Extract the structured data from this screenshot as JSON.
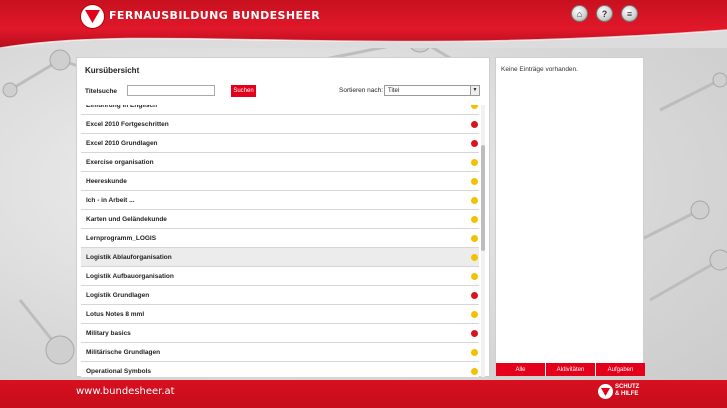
{
  "header": {
    "brand": "FERNAUSBILDUNG BUNDESHEER",
    "buttons": [
      {
        "name": "home-icon",
        "glyph": "⌂"
      },
      {
        "name": "help-icon",
        "glyph": "?"
      },
      {
        "name": "menu-icon",
        "glyph": "≡"
      }
    ],
    "brand_color": "#e0182a"
  },
  "course_panel": {
    "title": "Kursübersicht",
    "search_label": "Titelsuche",
    "search_value": "",
    "search_button": "Suchen",
    "sort_label": "Sortieren nach:",
    "sort_selected": "Titel"
  },
  "courses": [
    {
      "label": "Einführung in Englisch",
      "status": "yellow"
    },
    {
      "label": "Excel 2010 Fortgeschritten",
      "status": "red"
    },
    {
      "label": "Excel 2010 Grundlagen",
      "status": "red"
    },
    {
      "label": "Exercise organisation",
      "status": "yellow"
    },
    {
      "label": "Heereskunde",
      "status": "yellow"
    },
    {
      "label": "Ich - in Arbeit ...",
      "status": "yellow"
    },
    {
      "label": "Karten und Geländekunde",
      "status": "yellow"
    },
    {
      "label": "Lernprogramm_LOGIS",
      "status": "yellow"
    },
    {
      "label": "Logistik Ablauforganisation",
      "status": "yellow",
      "highlighted": true
    },
    {
      "label": "Logistik Aufbauorganisation",
      "status": "yellow"
    },
    {
      "label": "Logistik Grundlagen",
      "status": "red"
    },
    {
      "label": "Lotus Notes 8 mml",
      "status": "yellow"
    },
    {
      "label": "Military basics",
      "status": "red"
    },
    {
      "label": "Militärische Grundlagen",
      "status": "yellow"
    },
    {
      "label": "Operational Symbols",
      "status": "yellow"
    }
  ],
  "status_colors": {
    "red": "#d8141c",
    "yellow": "#f2c200"
  },
  "side_panel": {
    "message": "Keine Einträge vorhanden.",
    "tabs": [
      "Alle",
      "Aktivitäten",
      "Aufgaben"
    ]
  },
  "footer": {
    "url": "www.bundesheer.at",
    "logo_line1": "SCHUTZ",
    "logo_line2": "& HILFE"
  }
}
